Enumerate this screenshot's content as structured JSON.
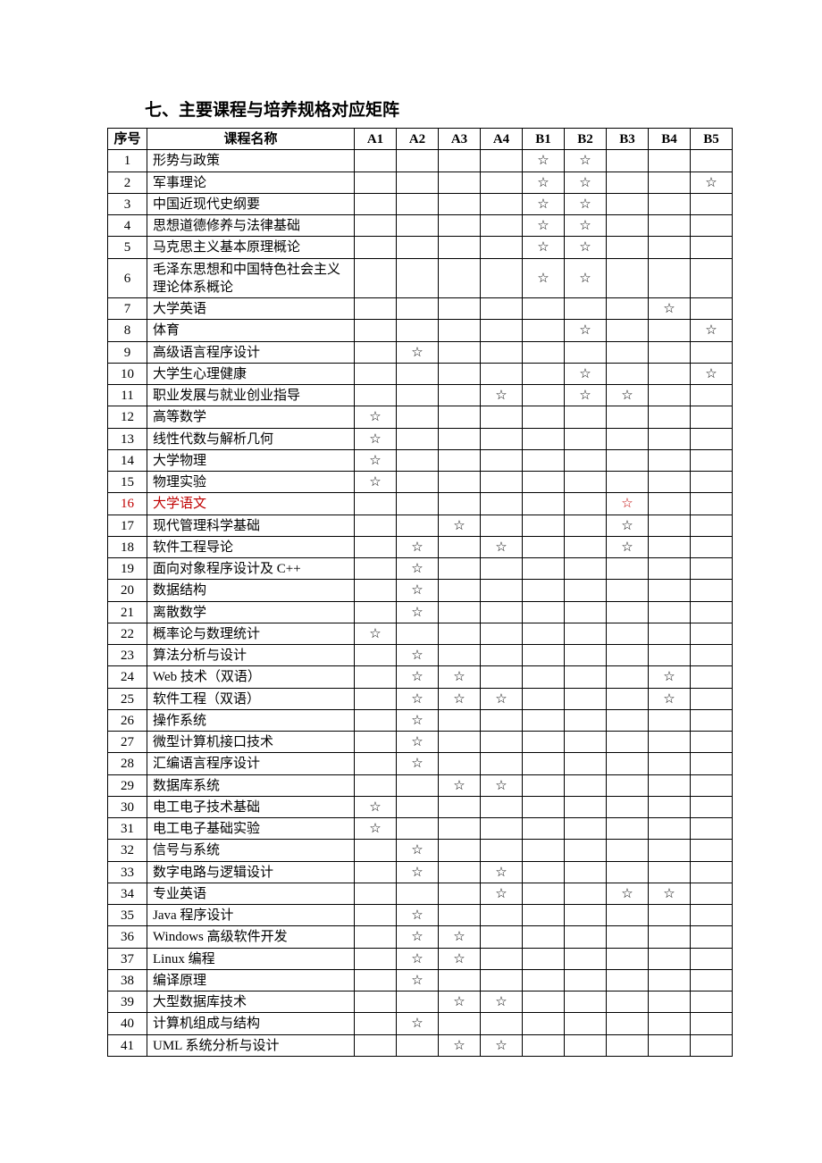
{
  "title": "七、主要课程与培养规格对应矩阵",
  "star": "☆",
  "headers": [
    "序号",
    "课程名称",
    "A1",
    "A2",
    "A3",
    "A4",
    "B1",
    "B2",
    "B3",
    "B4",
    "B5"
  ],
  "rows": [
    {
      "num": "1",
      "name": "形势与政策",
      "marks": [
        0,
        0,
        0,
        0,
        1,
        1,
        0,
        0,
        0
      ]
    },
    {
      "num": "2",
      "name": "军事理论",
      "marks": [
        0,
        0,
        0,
        0,
        1,
        1,
        0,
        0,
        1
      ]
    },
    {
      "num": "3",
      "name": "中国近现代史纲要",
      "marks": [
        0,
        0,
        0,
        0,
        1,
        1,
        0,
        0,
        0
      ]
    },
    {
      "num": "4",
      "name": "思想道德修养与法律基础",
      "marks": [
        0,
        0,
        0,
        0,
        1,
        1,
        0,
        0,
        0
      ]
    },
    {
      "num": "5",
      "name": "马克思主义基本原理概论",
      "marks": [
        0,
        0,
        0,
        0,
        1,
        1,
        0,
        0,
        0
      ]
    },
    {
      "num": "6",
      "name": "毛泽东思想和中国特色社会主义理论体系概论",
      "marks": [
        0,
        0,
        0,
        0,
        1,
        1,
        0,
        0,
        0
      ]
    },
    {
      "num": "7",
      "name": "大学英语",
      "marks": [
        0,
        0,
        0,
        0,
        0,
        0,
        0,
        1,
        0
      ]
    },
    {
      "num": "8",
      "name": "体育",
      "marks": [
        0,
        0,
        0,
        0,
        0,
        1,
        0,
        0,
        1
      ]
    },
    {
      "num": "9",
      "name": "高级语言程序设计",
      "marks": [
        0,
        1,
        0,
        0,
        0,
        0,
        0,
        0,
        0
      ]
    },
    {
      "num": "10",
      "name": "大学生心理健康",
      "marks": [
        0,
        0,
        0,
        0,
        0,
        1,
        0,
        0,
        1
      ]
    },
    {
      "num": "11",
      "name": "职业发展与就业创业指导",
      "marks": [
        0,
        0,
        0,
        1,
        0,
        1,
        1,
        0,
        0
      ]
    },
    {
      "num": "12",
      "name": "高等数学",
      "marks": [
        1,
        0,
        0,
        0,
        0,
        0,
        0,
        0,
        0
      ]
    },
    {
      "num": "13",
      "name": "线性代数与解析几何",
      "marks": [
        1,
        0,
        0,
        0,
        0,
        0,
        0,
        0,
        0
      ]
    },
    {
      "num": "14",
      "name": "大学物理",
      "marks": [
        1,
        0,
        0,
        0,
        0,
        0,
        0,
        0,
        0
      ]
    },
    {
      "num": "15",
      "name": "物理实验",
      "marks": [
        1,
        0,
        0,
        0,
        0,
        0,
        0,
        0,
        0
      ]
    },
    {
      "num": "16",
      "name": "大学语文",
      "marks": [
        0,
        0,
        0,
        0,
        0,
        0,
        1,
        0,
        0
      ],
      "red": true
    },
    {
      "num": "17",
      "name": "现代管理科学基础",
      "marks": [
        0,
        0,
        1,
        0,
        0,
        0,
        1,
        0,
        0
      ]
    },
    {
      "num": "18",
      "name": "软件工程导论",
      "marks": [
        0,
        1,
        0,
        1,
        0,
        0,
        1,
        0,
        0
      ]
    },
    {
      "num": "19",
      "name": "面向对象程序设计及 C++",
      "marks": [
        0,
        1,
        0,
        0,
        0,
        0,
        0,
        0,
        0
      ]
    },
    {
      "num": "20",
      "name": "数据结构",
      "marks": [
        0,
        1,
        0,
        0,
        0,
        0,
        0,
        0,
        0
      ]
    },
    {
      "num": "21",
      "name": "离散数学",
      "marks": [
        0,
        1,
        0,
        0,
        0,
        0,
        0,
        0,
        0
      ]
    },
    {
      "num": "22",
      "name": "概率论与数理统计",
      "marks": [
        1,
        0,
        0,
        0,
        0,
        0,
        0,
        0,
        0
      ]
    },
    {
      "num": "23",
      "name": "算法分析与设计",
      "marks": [
        0,
        1,
        0,
        0,
        0,
        0,
        0,
        0,
        0
      ]
    },
    {
      "num": "24",
      "name": "Web 技术（双语）",
      "marks": [
        0,
        1,
        1,
        0,
        0,
        0,
        0,
        1,
        0
      ]
    },
    {
      "num": "25",
      "name": "软件工程（双语）",
      "marks": [
        0,
        1,
        1,
        1,
        0,
        0,
        0,
        1,
        0
      ]
    },
    {
      "num": "26",
      "name": "操作系统",
      "marks": [
        0,
        1,
        0,
        0,
        0,
        0,
        0,
        0,
        0
      ]
    },
    {
      "num": "27",
      "name": "微型计算机接口技术",
      "marks": [
        0,
        1,
        0,
        0,
        0,
        0,
        0,
        0,
        0
      ]
    },
    {
      "num": "28",
      "name": "汇编语言程序设计",
      "marks": [
        0,
        1,
        0,
        0,
        0,
        0,
        0,
        0,
        0
      ]
    },
    {
      "num": "29",
      "name": "数据库系统",
      "marks": [
        0,
        0,
        1,
        1,
        0,
        0,
        0,
        0,
        0
      ]
    },
    {
      "num": "30",
      "name": "电工电子技术基础",
      "marks": [
        1,
        0,
        0,
        0,
        0,
        0,
        0,
        0,
        0
      ]
    },
    {
      "num": "31",
      "name": "电工电子基础实验",
      "marks": [
        1,
        0,
        0,
        0,
        0,
        0,
        0,
        0,
        0
      ]
    },
    {
      "num": "32",
      "name": "信号与系统",
      "marks": [
        0,
        1,
        0,
        0,
        0,
        0,
        0,
        0,
        0
      ]
    },
    {
      "num": "33",
      "name": "数字电路与逻辑设计",
      "marks": [
        0,
        1,
        0,
        1,
        0,
        0,
        0,
        0,
        0
      ]
    },
    {
      "num": "34",
      "name": "专业英语",
      "marks": [
        0,
        0,
        0,
        1,
        0,
        0,
        1,
        1,
        0
      ]
    },
    {
      "num": "35",
      "name": "Java 程序设计",
      "marks": [
        0,
        1,
        0,
        0,
        0,
        0,
        0,
        0,
        0
      ]
    },
    {
      "num": "36",
      "name": "Windows 高级软件开发",
      "marks": [
        0,
        1,
        1,
        0,
        0,
        0,
        0,
        0,
        0
      ]
    },
    {
      "num": "37",
      "name": "Linux 编程",
      "marks": [
        0,
        1,
        1,
        0,
        0,
        0,
        0,
        0,
        0
      ]
    },
    {
      "num": "38",
      "name": "编译原理",
      "marks": [
        0,
        1,
        0,
        0,
        0,
        0,
        0,
        0,
        0
      ]
    },
    {
      "num": "39",
      "name": "大型数据库技术",
      "marks": [
        0,
        0,
        1,
        1,
        0,
        0,
        0,
        0,
        0
      ]
    },
    {
      "num": "40",
      "name": "计算机组成与结构",
      "marks": [
        0,
        1,
        0,
        0,
        0,
        0,
        0,
        0,
        0
      ]
    },
    {
      "num": "41",
      "name": "UML 系统分析与设计",
      "marks": [
        0,
        0,
        1,
        1,
        0,
        0,
        0,
        0,
        0
      ]
    }
  ]
}
